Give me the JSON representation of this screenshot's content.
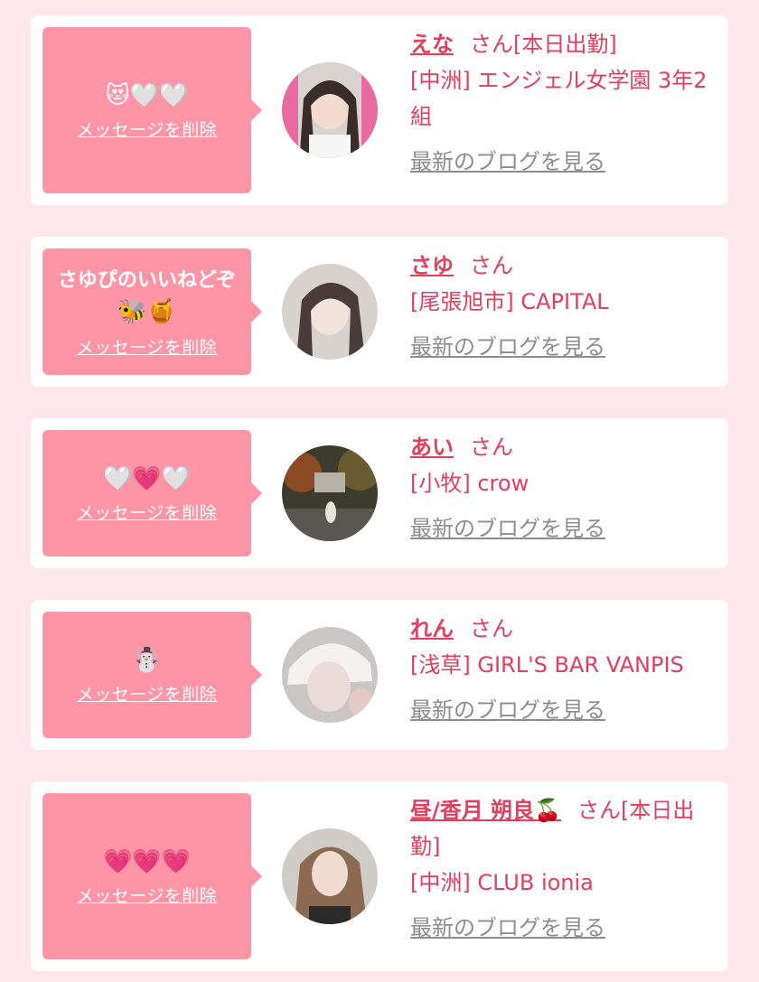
{
  "delete_label": "メッセージを削除",
  "blog_label": "最新のブログを見る",
  "colors": {
    "background": "#fde7ec",
    "bubble": "#fe95a7",
    "accent": "#e0405e",
    "link_gray": "#8d8d8d"
  },
  "cards": [
    {
      "message": "",
      "message_emoji": "😻🤍🤍",
      "name": "えな",
      "honorific": "さん[本日出勤]",
      "shop": "[中洲] エンジェル女学園 3年2組"
    },
    {
      "message": "さゆぴのいいねどぞ",
      "message_emoji": "🐝🍯",
      "name": "さゆ",
      "honorific": "さん",
      "shop": "[尾張旭市] CAPITAL"
    },
    {
      "message": "",
      "message_emoji": "🤍💗🤍",
      "name": "あい",
      "honorific": "さん",
      "shop": "[小牧] crow"
    },
    {
      "message": "",
      "message_emoji": "☃️",
      "name": "れん",
      "honorific": "さん",
      "shop": "[浅草] GIRL'S BAR VANPIS"
    },
    {
      "message": "",
      "message_emoji": "💗💗💗",
      "name": "昼/香月 朔良🍒",
      "honorific": "さん[本日出勤]",
      "shop": "[中洲] CLUB ionia"
    }
  ]
}
